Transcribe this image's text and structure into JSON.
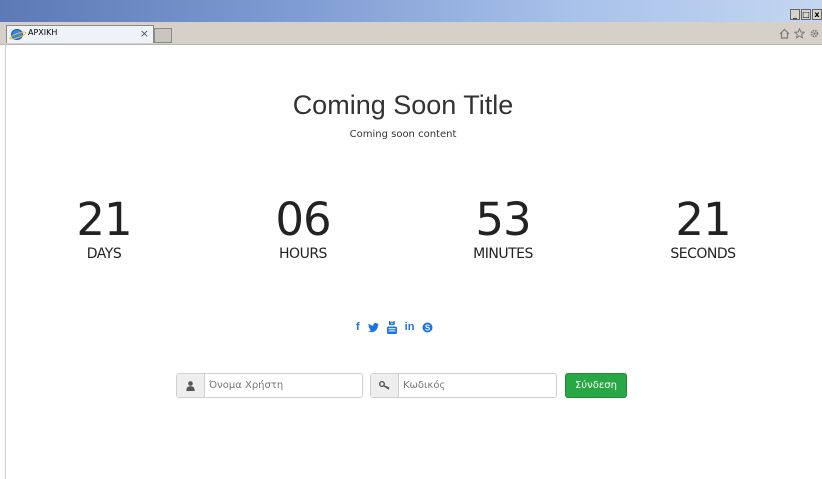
{
  "browser": {
    "tab_title": "ΑΡΧΙΚΗ",
    "tab_close": "×",
    "window_buttons": [
      "_",
      "□",
      "x"
    ],
    "toolbar_icons": [
      "home-icon",
      "star-icon",
      "gear-icon"
    ]
  },
  "hero": {
    "title": "Coming Soon Title",
    "content": "Coming soon content"
  },
  "countdown": [
    {
      "value": "21",
      "label": "DAYS"
    },
    {
      "value": "06",
      "label": "HOURS"
    },
    {
      "value": "53",
      "label": "MINUTES"
    },
    {
      "value": "21",
      "label": "SECONDS"
    }
  ],
  "social": [
    {
      "name": "facebook-icon",
      "glyph": "f"
    },
    {
      "name": "twitter-icon",
      "glyph": ""
    },
    {
      "name": "youtube-icon",
      "glyph": ""
    },
    {
      "name": "linkedin-icon",
      "glyph": "in"
    },
    {
      "name": "skype-icon",
      "glyph": "S"
    }
  ],
  "login": {
    "username_placeholder": "Όνομα Χρήστη",
    "password_placeholder": "Κωδικός",
    "submit_label": "Σύνδεση"
  },
  "colors": {
    "social_blue": "#1a73e8",
    "button_green": "#28a745"
  }
}
